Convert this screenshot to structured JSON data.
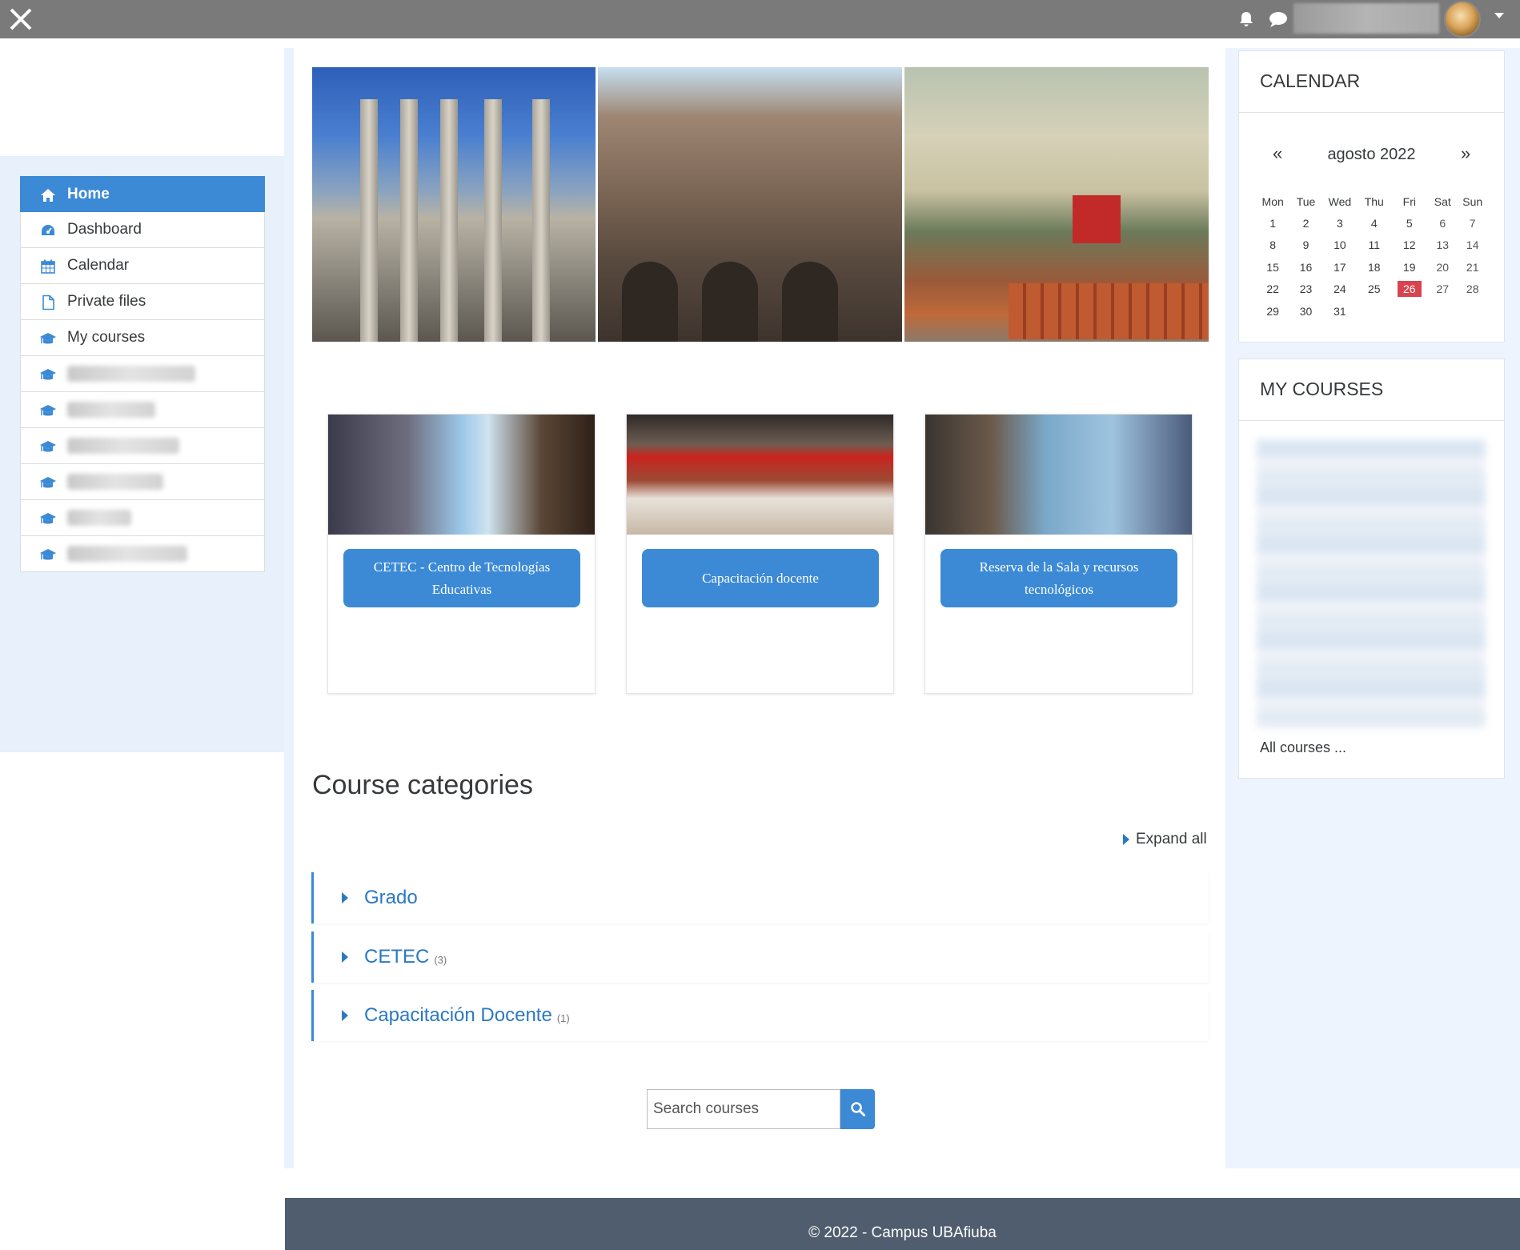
{
  "navbar": {
    "close_icon": "close-icon",
    "notifications_icon": "bell-icon",
    "messages_icon": "chat-icon",
    "user_menu_caret": "caret-down-icon"
  },
  "nav": {
    "items": [
      {
        "label": "Home",
        "icon": "home-icon",
        "active": true
      },
      {
        "label": "Dashboard",
        "icon": "dashboard-icon"
      },
      {
        "label": "Calendar",
        "icon": "calendar-icon"
      },
      {
        "label": "Private files",
        "icon": "file-icon"
      },
      {
        "label": "My courses",
        "icon": "graduation-cap-icon"
      }
    ],
    "course_count_blurred": 6
  },
  "cards": [
    {
      "label": "CETEC - Centro de Tecnologías Educativas"
    },
    {
      "label": "Capacitación docente"
    },
    {
      "label": "Reserva de la Sala y recursos tecnológicos"
    }
  ],
  "categories": {
    "title": "Course categories",
    "expand_all": "Expand all",
    "items": [
      {
        "name": "Grado",
        "count": ""
      },
      {
        "name": "CETEC",
        "count": "(3)"
      },
      {
        "name": "Capacitación Docente",
        "count": "(1)"
      }
    ]
  },
  "search": {
    "placeholder": "Search courses",
    "icon": "search-icon"
  },
  "calendar": {
    "title": "CALENDAR",
    "prev": "«",
    "next": "»",
    "month": "agosto 2022",
    "weekdays": [
      "Mon",
      "Tue",
      "Wed",
      "Thu",
      "Fri",
      "Sat",
      "Sun"
    ],
    "weeks": [
      [
        "1",
        "2",
        "3",
        "4",
        "5",
        "6",
        "7"
      ],
      [
        "8",
        "9",
        "10",
        "11",
        "12",
        "13",
        "14"
      ],
      [
        "15",
        "16",
        "17",
        "18",
        "19",
        "20",
        "21"
      ],
      [
        "22",
        "23",
        "24",
        "25",
        "26",
        "27",
        "28"
      ],
      [
        "29",
        "30",
        "31",
        "",
        "",
        "",
        ""
      ]
    ],
    "today": "26",
    "today_color": "#d9434f"
  },
  "my_courses": {
    "title": "MY COURSES",
    "all_courses": "All courses ..."
  },
  "footer": {
    "text": "© 2022 - Campus UBAfiuba"
  },
  "colors": {
    "accent": "#3c8ad6",
    "link": "#2b79c2",
    "navbar": "#7a7a7a",
    "footer": "#4f5d6e"
  }
}
